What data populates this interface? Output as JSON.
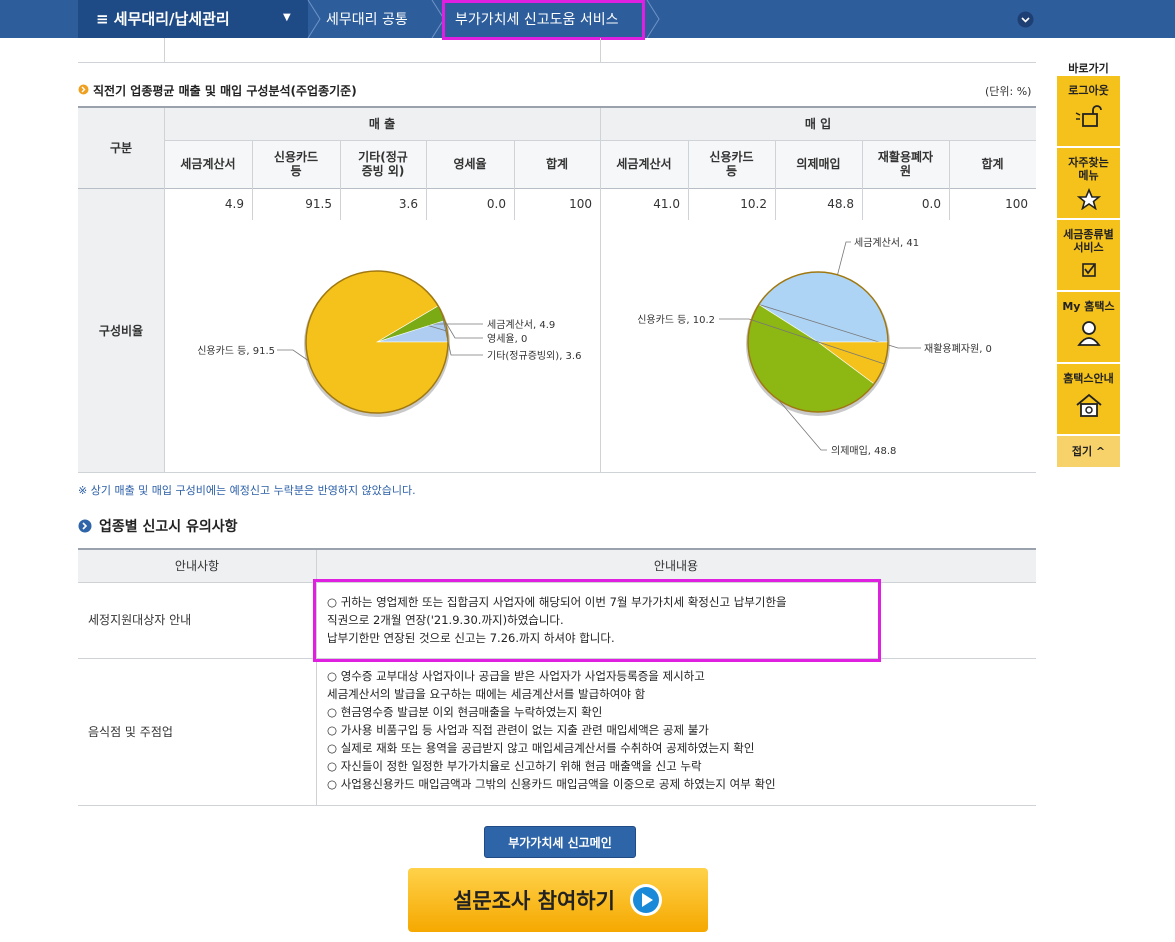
{
  "nav": {
    "menu_title": "≡  세무대리/납세관리",
    "crumb1": "세무대리 공통",
    "crumb2": "부가가치세 신고도움 서비스"
  },
  "section1": {
    "title": "직전기 업종평균 매출 및 매입 구성분석(주업종기준)",
    "unit": "(단위: %)",
    "col_gubun": "구분",
    "sales_header": "매 출",
    "purchase_header": "매 입",
    "sales_cols": [
      "세금계산서",
      "신용카드\n등",
      "기타(정규\n증빙 외)",
      "영세율",
      "합계"
    ],
    "purchase_cols": [
      "세금계산서",
      "신용카드\n등",
      "의제매입",
      "재활용폐자\n원",
      "합계"
    ],
    "sales_values": [
      "4.9",
      "91.5",
      "3.6",
      "0.0",
      "100"
    ],
    "purchase_values": [
      "41.0",
      "10.2",
      "48.8",
      "0.0",
      "100"
    ],
    "row_label": "구성비율",
    "footnote": "※ 상기 매출 및 매입 구성비에는 예정신고 누락분은 반영하지 않았습니다."
  },
  "chart_data": [
    {
      "type": "pie",
      "slices": [
        {
          "label": "세금계산서, 4.9",
          "value": 4.9,
          "color": "#aecdf0"
        },
        {
          "label": "영세율, 0",
          "value": 0,
          "color": "#cccccc"
        },
        {
          "label": "기타(정규증빙외), 3.6",
          "value": 3.6,
          "color": "#7aab14"
        },
        {
          "label": "신용카드 등, 91.5",
          "value": 91.5,
          "color": "#f5c21b"
        }
      ]
    },
    {
      "type": "pie",
      "slices": [
        {
          "label": "세금계산서, 41",
          "value": 41,
          "color": "#aed4f5"
        },
        {
          "label": "재활용폐자원, 0",
          "value": 0,
          "color": "#cccccc"
        },
        {
          "label": "의제매입, 48.8",
          "value": 48.8,
          "color": "#8db814"
        },
        {
          "label": "신용카드 등, 10.2",
          "value": 10.2,
          "color": "#f5c21b"
        }
      ]
    }
  ],
  "section2": {
    "title": "업종별 신고시 유의사항",
    "col1": "안내사항",
    "col2": "안내내용",
    "row1_label": "세정지원대상자 안내",
    "row1_lines": [
      "○ 귀하는 영업제한 또는 집합금지 사업자에 해당되어 이번 7월 부가가치세 확정신고 납부기한을",
      "직권으로 2개월 연장('21.9.30.까지)하였습니다.",
      "납부기한만 연장된 것으로 신고는 7.26.까지 하셔야 합니다."
    ],
    "row2_label": "음식점 및 주점업",
    "row2_lines": [
      "○ 영수증 교부대상 사업자이나 공급을 받은 사업자가 사업자등록증을 제시하고",
      "세금계산서의 발급을 요구하는 때에는 세금계산서를 발급하여야 함",
      "○ 현금영수증 발급분 이외 현금매출을 누락하였는지 확인",
      "○ 가사용 비품구입 등 사업과 직접 관련이 없는 지출 관련 매입세액은 공제 불가",
      "○ 실제로 재화 또는 용역을 공급받지 않고 매입세금계산서를 수취하여 공제하였는지 확인",
      "○ 자신들이 정한 일정한 부가가치율로 신고하기 위해 현금 매출액을 신고 누락",
      "○ 사업용신용카드 매입금액과 그밖의 신용카드 매입금액을 이중으로 공제 하였는지 여부 확인"
    ]
  },
  "quick": {
    "title": "바로가기",
    "items": [
      "로그아웃",
      "자주찾는\n메뉴",
      "세금종류별\n서비스",
      "My 홈택스",
      "홈택스안내"
    ],
    "close": "접기 ^"
  },
  "buttons": {
    "main": "부가가치세 신고메인",
    "survey": "설문조사 참여하기"
  }
}
